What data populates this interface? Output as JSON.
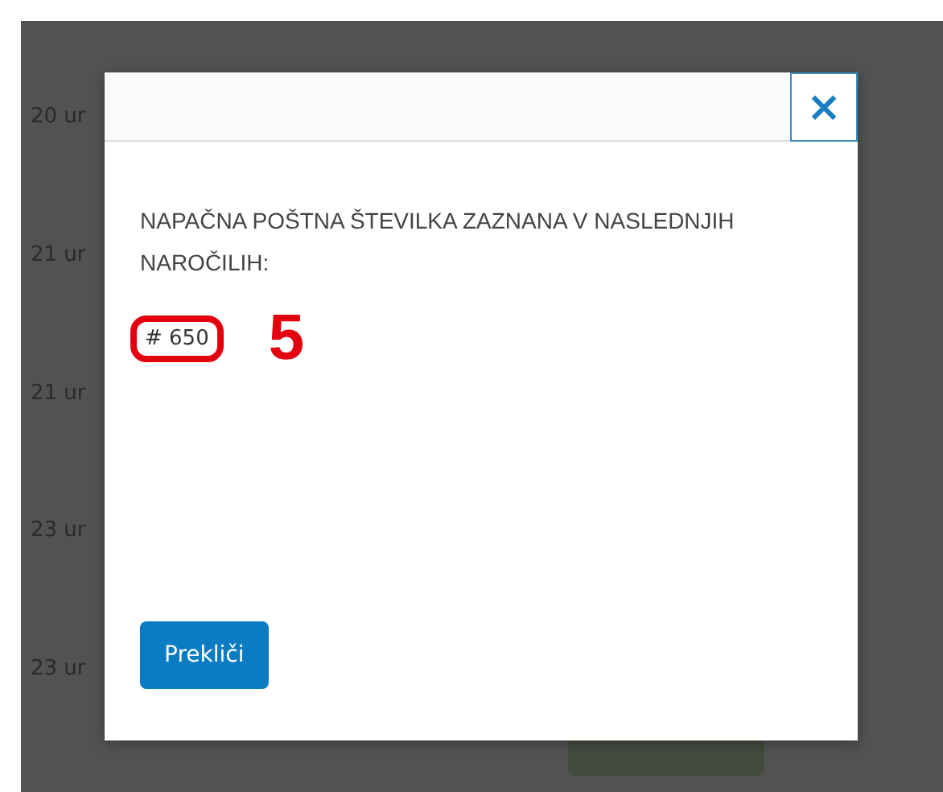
{
  "background": {
    "rows": [
      "20 ur",
      "21 ur",
      "21 ur",
      "23 ur",
      "23 ur"
    ]
  },
  "modal": {
    "close_label": "×",
    "message": "NAPAČNA POŠTNA ŠTEVILKA ZAZNANA V NASLEDNJIH NAROČILIH:",
    "orders": [
      "# 650"
    ],
    "annotation": "5",
    "buttons": [
      "Prekliči"
    ]
  }
}
